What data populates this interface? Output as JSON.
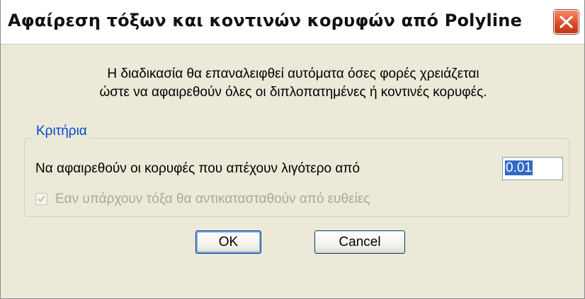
{
  "window": {
    "title": "Αφαίρεση τόξων και κοντινών κορυφών από Polyline"
  },
  "description": {
    "line1": "Η διαδικασία θα επαναλειφθεί αυτόματα όσες φορές χρειάζεται",
    "line2": "ώστε να αφαιρεθούν όλες οι διπλοπατημένες ή κοντινές κορυφές."
  },
  "criteria": {
    "legend": "Κριτήρια",
    "distance_label": "Να αφαιρεθούν οι κορυφές που απέχουν λιγότερο από",
    "distance_value": "0.01",
    "arcs_checkbox_label": "Εαν υπάρχουν τόξα θα αντικατασταθούν από ευθείες",
    "arcs_checkbox_checked": true,
    "arcs_checkbox_enabled": false
  },
  "buttons": {
    "ok": "OK",
    "cancel": "Cancel"
  },
  "icons": {
    "close": "close-icon",
    "check": "check-icon"
  },
  "colors": {
    "dialog_bg": "#ece9d8",
    "legend_text": "#0046d5",
    "close_button": "#d64a24",
    "selection": "#316ac5"
  }
}
